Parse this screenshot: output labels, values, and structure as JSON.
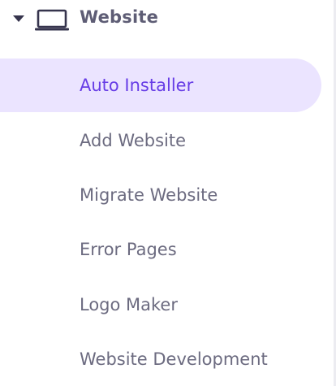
{
  "section": {
    "title": "Website",
    "expanded": true,
    "caret_icon": "caret-down-icon",
    "icon": "laptop-icon"
  },
  "menu": {
    "items": [
      {
        "label": "Auto Installer",
        "active": true
      },
      {
        "label": "Add Website",
        "active": false
      },
      {
        "label": "Migrate Website",
        "active": false
      },
      {
        "label": "Error Pages",
        "active": false
      },
      {
        "label": "Logo Maker",
        "active": false
      },
      {
        "label": "Website Development",
        "active": false
      }
    ]
  },
  "colors": {
    "active_bg": "#ebe4ff",
    "active_text": "#673de6",
    "text": "#6c6b80",
    "header_text": "#5e5d75",
    "icon": "#36344d"
  }
}
